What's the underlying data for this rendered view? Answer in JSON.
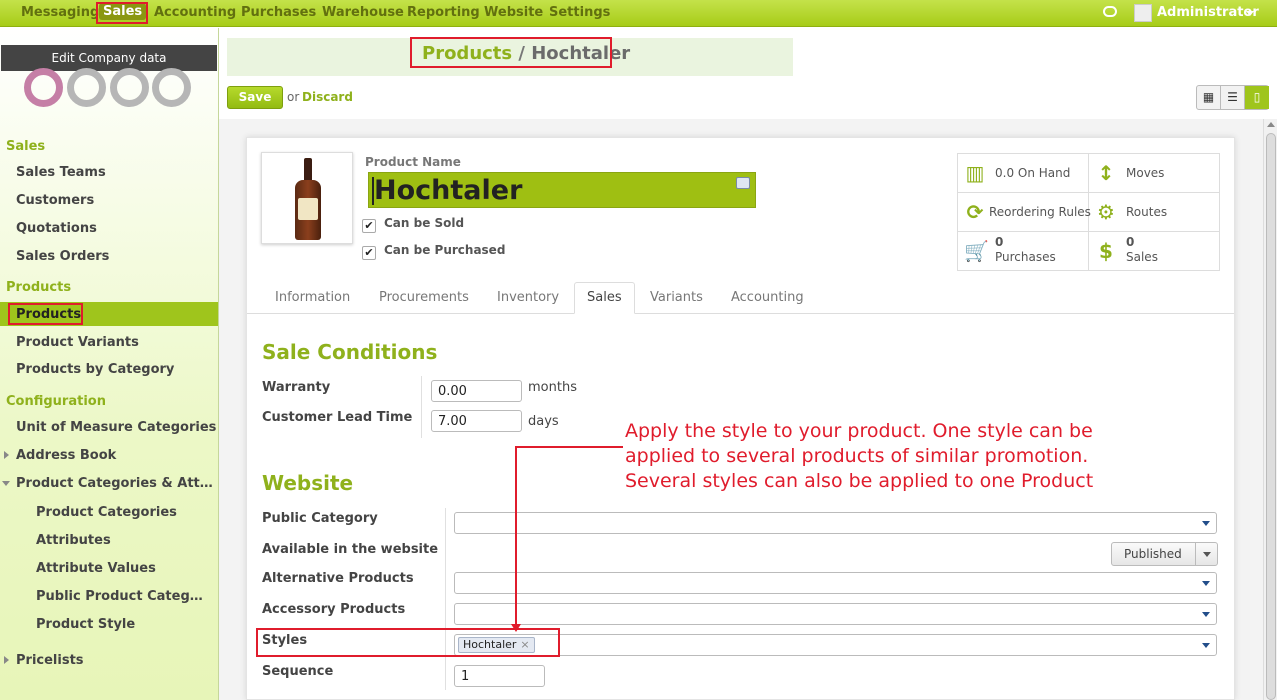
{
  "topnav": {
    "items": [
      "Messaging",
      "Sales",
      "Accounting",
      "Purchases",
      "Warehouse",
      "Reporting",
      "Website",
      "Settings"
    ],
    "active": "Sales",
    "user": "Administrator"
  },
  "sidebar": {
    "edit_company": "Edit Company data",
    "sections": {
      "sales": "Sales",
      "products": "Products",
      "configuration": "Configuration"
    },
    "sales_items": [
      "Sales Teams",
      "Customers",
      "Quotations",
      "Sales Orders"
    ],
    "products_items": [
      "Products",
      "Product Variants",
      "Products by Category"
    ],
    "config_items": [
      "Unit of Measure Categories",
      "Address Book",
      "Product Categories & Att…"
    ],
    "config_subitems": [
      "Product Categories",
      "Attributes",
      "Attribute Values",
      "Public Product Categ…",
      "Product Style"
    ],
    "pricelists": "Pricelists"
  },
  "header": {
    "breadcrumb_parent": "Products",
    "breadcrumb_sep": " / ",
    "breadcrumb_current": "Hochtaler",
    "save_label": "Save",
    "or_label": "or",
    "discard_label": "Discard"
  },
  "product": {
    "name_label": "Product Name",
    "name": "Hochtaler",
    "can_be_sold_label": "Can be Sold",
    "can_be_purchased_label": "Can be Purchased",
    "can_be_sold": true,
    "can_be_purchased": true
  },
  "stats": {
    "on_hand": "0.0 On Hand",
    "moves": "Moves",
    "reordering": "Reordering Rules",
    "routes": "Routes",
    "purchases_count": "0",
    "purchases_label": "Purchases",
    "sales_count": "0",
    "sales_label": "Sales"
  },
  "tabs": [
    "Information",
    "Procurements",
    "Inventory",
    "Sales",
    "Variants",
    "Accounting"
  ],
  "active_tab": "Sales",
  "sale_conditions": {
    "title": "Sale Conditions",
    "warranty_label": "Warranty",
    "warranty_value": "0.00",
    "warranty_unit": "months",
    "lead_time_label": "Customer Lead Time",
    "lead_time_value": "7.00",
    "lead_time_unit": "days"
  },
  "website": {
    "title": "Website",
    "public_category_label": "Public Category",
    "available_label": "Available in the website",
    "published_label": "Published",
    "alternative_label": "Alternative Products",
    "accessory_label": "Accessory Products",
    "styles_label": "Styles",
    "style_tag": "Hochtaler",
    "sequence_label": "Sequence",
    "sequence_value": "1"
  },
  "annotation": {
    "lines": [
      "Apply the style to your product. One style can be",
      "applied to several products of similar promotion.",
      "Several styles can also be applied to one Product"
    ],
    "color": "#e01c2c"
  },
  "colors": {
    "accent": "#9fc51c",
    "accent_text": "#8fb11c"
  }
}
